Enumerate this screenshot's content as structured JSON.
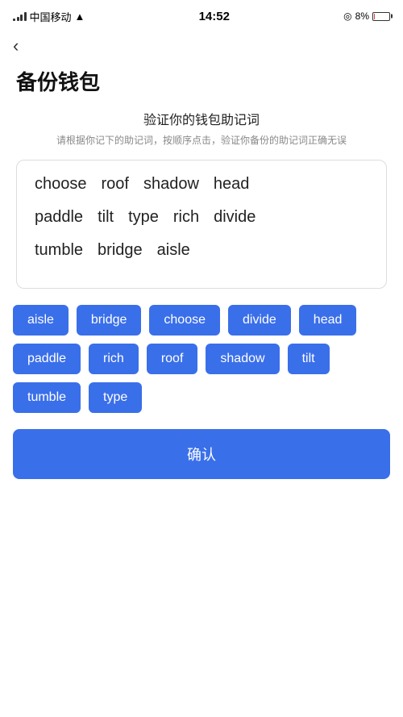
{
  "statusBar": {
    "carrier": "中国移动",
    "time": "14:52",
    "battery": "8%"
  },
  "backButton": "‹",
  "pageTitle": "备份钱包",
  "sectionHeading": "验证你的钱包助记词",
  "sectionDesc": "请根据你记下的助记词，按顺序点击，验证你备份的助记词正确无误",
  "displayWords": [
    "choose",
    "roof",
    "shadow",
    "head",
    "paddle",
    "tilt",
    "type",
    "rich",
    "divide",
    "tumble",
    "bridge",
    "aisle"
  ],
  "chips": [
    "aisle",
    "bridge",
    "choose",
    "divide",
    "head",
    "paddle",
    "rich",
    "roof",
    "shadow",
    "tilt",
    "tumble",
    "type"
  ],
  "confirmLabel": "确认"
}
